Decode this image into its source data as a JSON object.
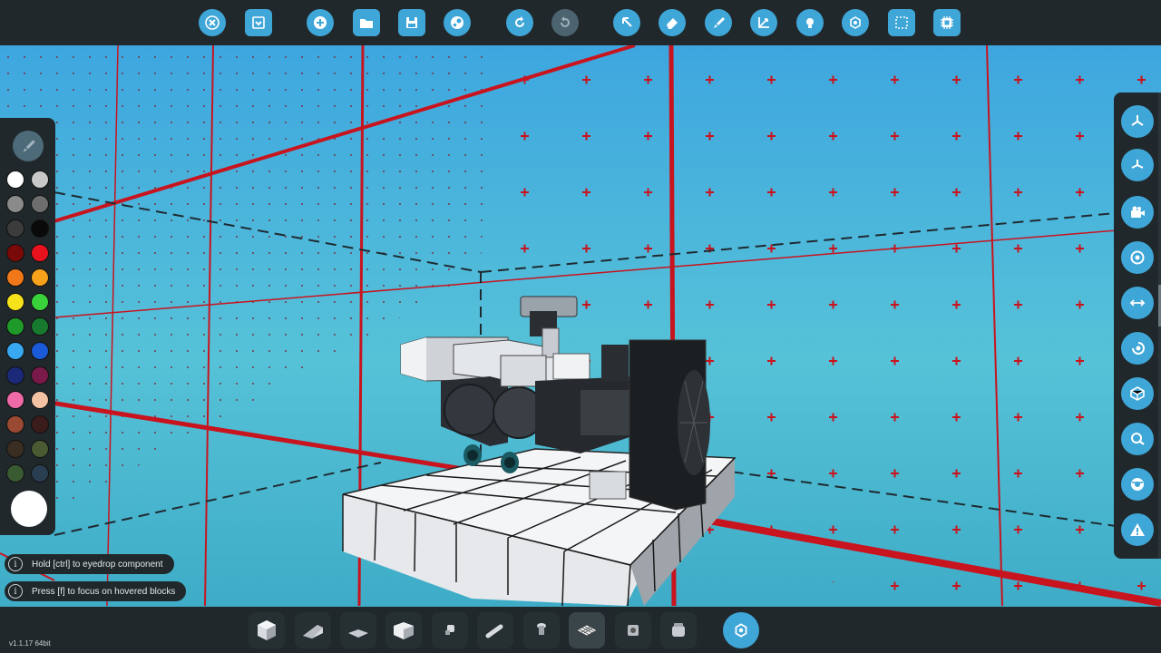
{
  "toolbar": {
    "buttons": [
      {
        "name": "close-icon",
        "group": 1
      },
      {
        "name": "collapse-menu-icon",
        "group": 1
      },
      {
        "name": "new-icon",
        "group": 2
      },
      {
        "name": "open-folder-icon",
        "group": 2
      },
      {
        "name": "save-icon",
        "group": 2
      },
      {
        "name": "steam-workshop-icon",
        "group": 2
      },
      {
        "name": "undo-icon",
        "group": 3
      },
      {
        "name": "redo-icon",
        "group": 3,
        "disabled": true
      },
      {
        "name": "select-pointer-icon",
        "group": 4
      },
      {
        "name": "eraser-icon",
        "group": 4
      },
      {
        "name": "paint-brush-icon",
        "group": 4
      },
      {
        "name": "transform-axes-icon",
        "group": 4
      },
      {
        "name": "light-bulb-icon",
        "group": 4
      },
      {
        "name": "logic-nodes-icon",
        "group": 4
      },
      {
        "name": "selection-box-icon",
        "group": 4
      },
      {
        "name": "microprocessor-icon",
        "group": 4
      }
    ]
  },
  "palette": {
    "swatches": [
      "#ffffff",
      "#c9c9c9",
      "#8a8a8a",
      "#6e6e6e",
      "#3c3c3c",
      "#0a0a0a",
      "#7a0a0a",
      "#e8121e",
      "#f07818",
      "#f6a21a",
      "#f6e21a",
      "#3ad23a",
      "#1f9a2a",
      "#177a2e",
      "#38a8f0",
      "#1a5ad8",
      "#1a2a78",
      "#7a1a4a",
      "#f06aa8",
      "#f2c2a2",
      "#9a4a32",
      "#3a1c1a",
      "#3a2e22",
      "#4a5a32",
      "#3a5a32",
      "#2a3e52"
    ],
    "current_color": "#ffffff"
  },
  "right_toolbar": {
    "buttons": [
      "view-orthographic-icon",
      "view-perspective-icon",
      "camera-icon",
      "center-target-icon",
      "symmetry-icon",
      "rotate-view-icon",
      "block-view-icon",
      "inspect-icon",
      "visibility-icon",
      "warning-icon"
    ]
  },
  "hints": [
    {
      "icon": "info-icon",
      "text": "Hold [ctrl] to eyedrop component"
    },
    {
      "icon": "info-icon",
      "text": "Press [f] to focus on hovered blocks"
    }
  ],
  "bottom_bar": {
    "items": [
      "block-cube-icon",
      "wedge-block-icon",
      "slope-block-icon",
      "pyramid-block-icon",
      "connector-icon",
      "pipe-icon",
      "fitting-icon",
      "grate-icon",
      "mechanical-part-icon",
      "engine-part-icon"
    ],
    "selected_index": 7,
    "action_icon": "logic-nodes-icon"
  },
  "version": "v1.1.17 64bit",
  "colors": {
    "accent": "#3fa6d8",
    "panel": "#20282b",
    "grid_red": "#c8141e"
  }
}
